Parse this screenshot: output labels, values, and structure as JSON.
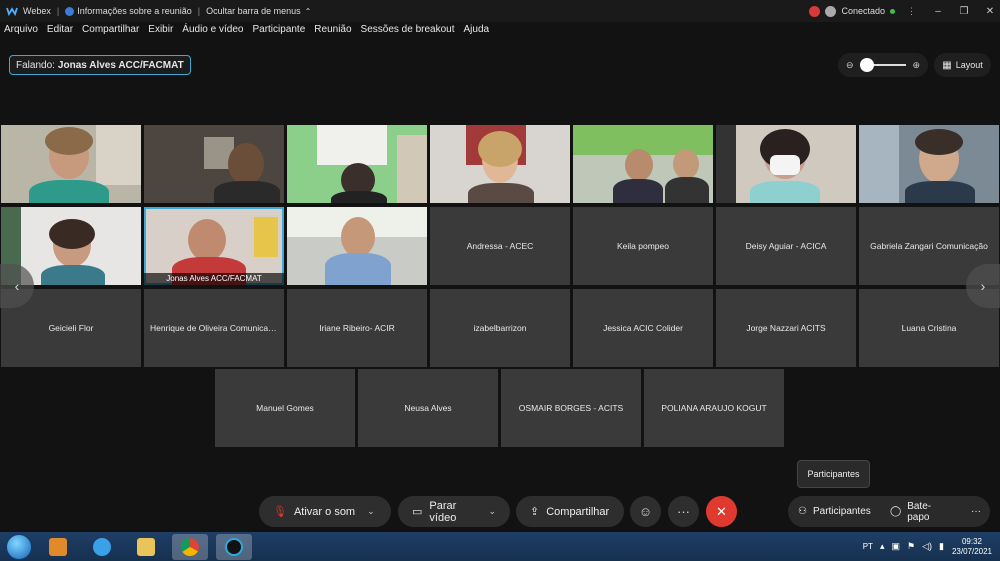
{
  "titlebar": {
    "app": "Webex",
    "meeting_info": "Informações sobre a reunião",
    "hide_menu": "Ocultar barra de menus",
    "connection": "Conectado",
    "min": "–",
    "restore": "❐",
    "close": "✕"
  },
  "menu": [
    "Arquivo",
    "Editar",
    "Compartilhar",
    "Exibir",
    "Áudio e vídeo",
    "Participante",
    "Reunião",
    "Sessões de breakout",
    "Ajuda"
  ],
  "speaking": {
    "label": "Falando:",
    "name": "Jonas Alves ACC/FACMAT"
  },
  "layout": {
    "label": "Layout"
  },
  "zoom": {
    "minus": "⊖",
    "plus": "⊕",
    "level": 0
  },
  "active_speaker_caption": "Jonas Alves ACC/FACMAT",
  "participants_names": [
    "Andressa - ACEC",
    "Keila pompeo",
    "Deisy Aguiar - ACICA",
    "Gabriela Zangari Comunicação",
    "Geicieli Flor",
    "Henrique de Oliveira Comunicação",
    "Iriane Ribeiro- ACIR",
    "izabelbarrizon",
    "Jessica ACIC Colider",
    "Jorge Nazzari ACITS",
    "Luana Cristina",
    "Manuel Gomes",
    "Neusa Alves",
    "OSMAIR BORGES - ACITS",
    "POLIANA ARAUJO KOGUT"
  ],
  "tooltip": "Participantes",
  "controls": {
    "mute": "Ativar o som",
    "video": "Parar vídeo",
    "share": "Compartilhar",
    "participants": "Participantes",
    "chat": "Bate-papo",
    "more": "···",
    "end": "✕"
  },
  "taskbar": {
    "lang": "PT",
    "time": "09:32",
    "date": "23/07/2021"
  },
  "colors": {
    "accent": "#3fa9d5",
    "end": "#e0392f",
    "connected": "#3fbf4f"
  }
}
